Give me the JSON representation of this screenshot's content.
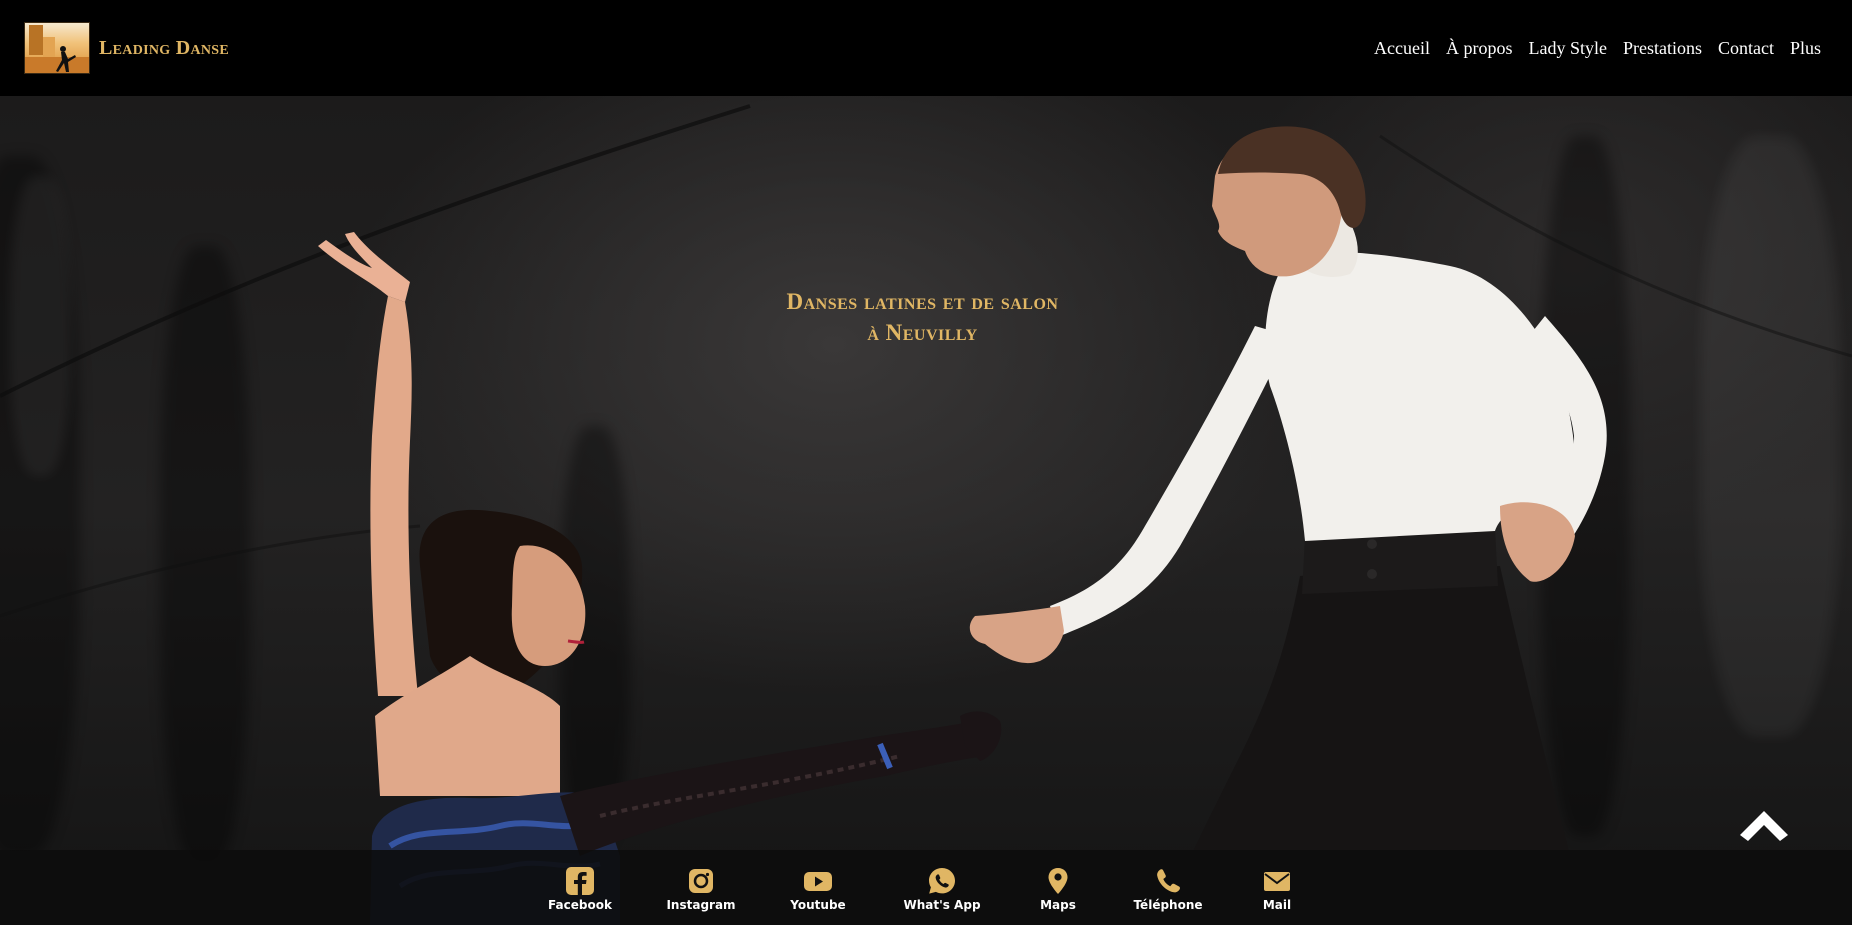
{
  "brand": {
    "name": "Leading Danse"
  },
  "nav": {
    "items": [
      {
        "label": "Accueil"
      },
      {
        "label": "À propos"
      },
      {
        "label": "Lady Style"
      },
      {
        "label": "Prestations"
      },
      {
        "label": "Contact"
      },
      {
        "label": "Plus"
      }
    ]
  },
  "hero": {
    "line1": "Danses latines et de salon",
    "line2": "à Neuvilly"
  },
  "footer": {
    "items": [
      {
        "label": "Facebook",
        "icon": "facebook-icon"
      },
      {
        "label": "Instagram",
        "icon": "instagram-icon"
      },
      {
        "label": "Youtube",
        "icon": "youtube-icon"
      },
      {
        "label": "What's App",
        "icon": "whatsapp-icon"
      },
      {
        "label": "Maps",
        "icon": "map-pin-icon"
      },
      {
        "label": "Téléphone",
        "icon": "phone-icon"
      },
      {
        "label": "Mail",
        "icon": "mail-icon"
      }
    ]
  },
  "colors": {
    "accent": "#e0b664",
    "background": "#000000",
    "footer_icon": "#e0b664"
  }
}
